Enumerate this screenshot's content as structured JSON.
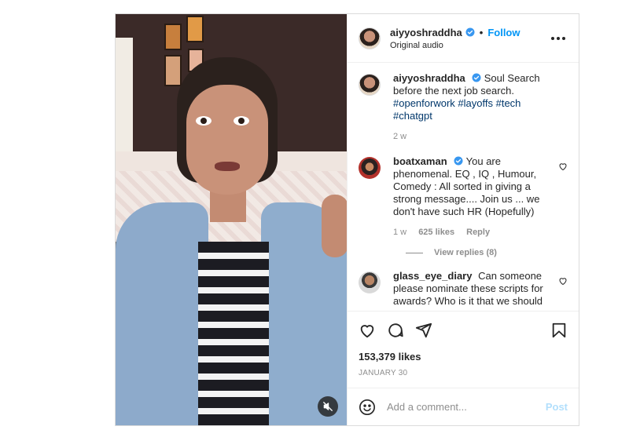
{
  "post": {
    "author": "aiyyoshraddha",
    "header": {
      "username": "aiyyoshraddha",
      "separator": "•",
      "follow_label": "Follow",
      "subtitle": "Original audio",
      "more_icon": "more-options-icon"
    },
    "caption": {
      "username": "aiyyoshraddha",
      "text": "Soul Search before the next job search.",
      "hashtags": [
        "#openforwork",
        "#layoffs",
        "#tech",
        "#chatgpt"
      ],
      "time": "2 w"
    },
    "comments": [
      {
        "username": "boatxaman",
        "verified": true,
        "text": "You are phenomenal. EQ , IQ , Humour, Comedy : All sorted in giving a strong message.... Join us ... we don't have such HR (Hopefully)",
        "time": "1 w",
        "likes": "625 likes",
        "reply_label": "Reply",
        "view_replies": "View replies (8)"
      },
      {
        "username": "glass_eye_diary",
        "verified": false,
        "text": "Can someone please nominate these scripts for awards? Who is it that we should"
      }
    ],
    "likes_count": "153,379 likes",
    "date": "JANUARY 30",
    "comment_input": {
      "placeholder": "Add a comment...",
      "post_label": "Post"
    }
  },
  "colors": {
    "accent": "#0095f6",
    "verified": "#3897f0",
    "muted_text": "#8e8e8e",
    "hashtag": "#00376b",
    "post_disabled": "#b2dffc"
  }
}
